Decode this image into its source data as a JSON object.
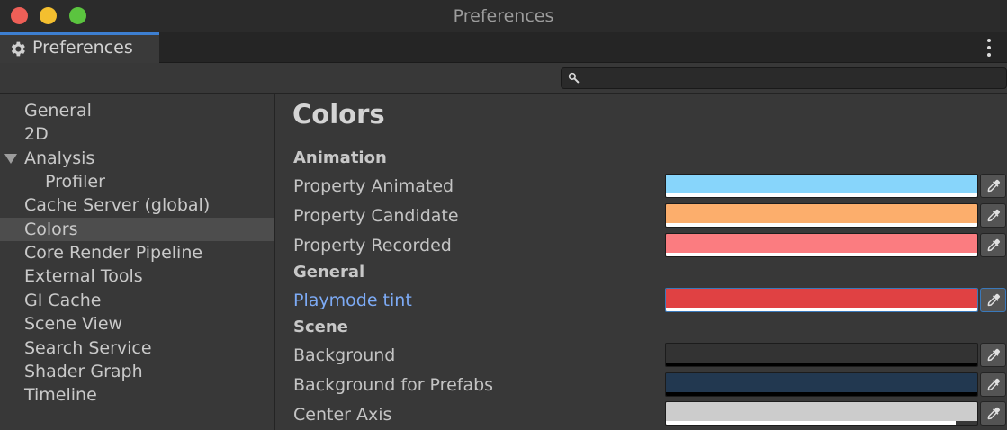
{
  "window": {
    "title": "Preferences"
  },
  "tab": {
    "label": "Preferences",
    "icon": "gear-icon"
  },
  "search": {
    "value": "",
    "placeholder": ""
  },
  "sidebar": {
    "items": [
      {
        "label": "General"
      },
      {
        "label": "2D"
      },
      {
        "label": "Analysis",
        "expanded": true
      },
      {
        "label": "Profiler",
        "child": true
      },
      {
        "label": "Cache Server (global)"
      },
      {
        "label": "Colors",
        "selected": true
      },
      {
        "label": "Core Render Pipeline"
      },
      {
        "label": "External Tools"
      },
      {
        "label": "GI Cache"
      },
      {
        "label": "Scene View"
      },
      {
        "label": "Search Service"
      },
      {
        "label": "Shader Graph"
      },
      {
        "label": "Timeline"
      }
    ]
  },
  "main": {
    "title": "Colors",
    "sections": [
      {
        "heading": "Animation",
        "props": [
          {
            "label": "Property Animated",
            "color": "#87d5fb",
            "alpha_bar": "#ffffff"
          },
          {
            "label": "Property Candidate",
            "color": "#fcae6c",
            "alpha_bar": "#ffffff"
          },
          {
            "label": "Property Recorded",
            "color": "#fb7c80",
            "alpha_bar": "#ffffff"
          }
        ]
      },
      {
        "heading": "General",
        "props": [
          {
            "label": "Playmode tint",
            "color": "#e04143",
            "alpha_bar": "#ffffff",
            "focused": true
          }
        ]
      },
      {
        "heading": "Scene",
        "props": [
          {
            "label": "Background",
            "color": "#333333",
            "alpha_bar": "#000000"
          },
          {
            "label": "Background for Prefabs",
            "color": "#223850",
            "alpha_bar": "#000000"
          },
          {
            "label": "Center Axis",
            "color": "#cccccc",
            "alpha_bar": "#ffffff"
          }
        ]
      }
    ]
  }
}
